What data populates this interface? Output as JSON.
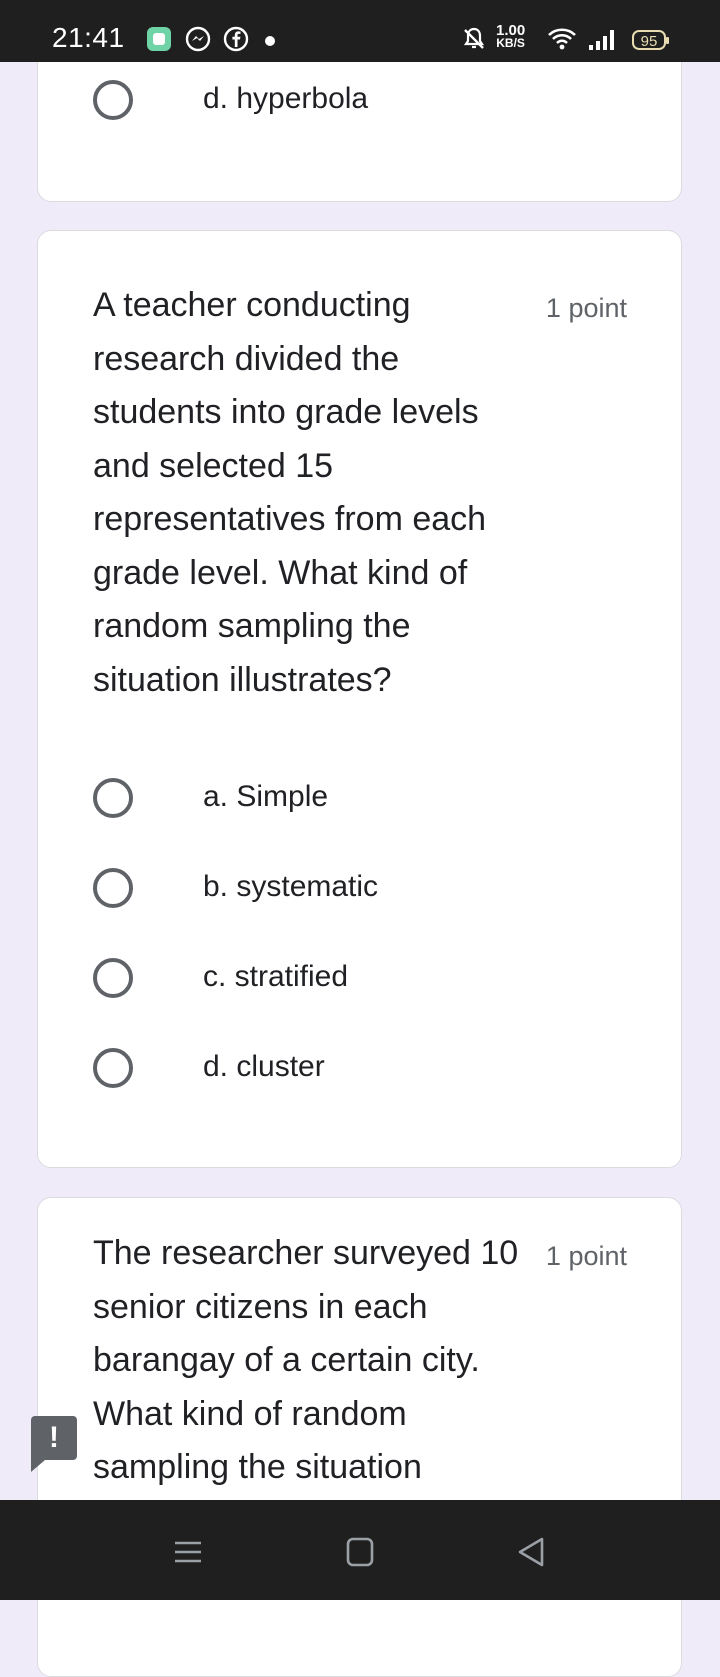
{
  "status_bar": {
    "time": "21:41",
    "net_speed_value": "1.00",
    "net_speed_unit": "KB/S",
    "battery": "95",
    "icons": [
      "app-icon",
      "messenger-icon",
      "facebook-icon",
      "notification-dot",
      "mute-icon",
      "wifi-icon",
      "signal-icon",
      "battery-icon"
    ]
  },
  "prev_question": {
    "options": [
      "d. hyperbola"
    ]
  },
  "question1": {
    "text": "A teacher conducting research divided the students into grade levels and selected 15 representatives from each grade level. What kind of random sampling the situation illustrates?",
    "points": "1 point",
    "options": [
      "a. Simple",
      "b. systematic",
      "c. stratified",
      "d. cluster"
    ]
  },
  "question2": {
    "text": "The researcher surveyed 10 senior citizens in each barangay of a certain city. What kind of random sampling the situation",
    "points": "1 point"
  },
  "feedback": {
    "label": "!"
  },
  "nav_bar": {
    "icons": [
      "menu-icon",
      "home-icon",
      "back-icon"
    ]
  },
  "colors": {
    "page_bg": "#f0ebf8",
    "card_bg": "#ffffff",
    "bar_bg": "#1f1f1f",
    "radio": "#5f6368"
  }
}
